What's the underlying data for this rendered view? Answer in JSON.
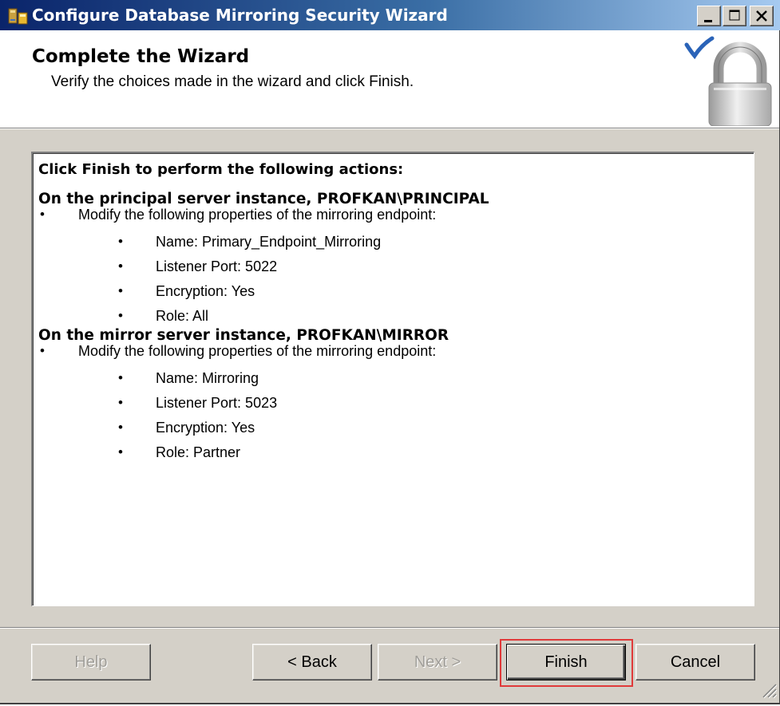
{
  "window": {
    "title": "Configure Database Mirroring Security Wizard",
    "controls": {
      "minimize": "minimize",
      "maximize": "maximize",
      "close": "close"
    }
  },
  "header": {
    "title": "Complete the Wizard",
    "subtitle": "Verify the choices made in the wizard and click Finish.",
    "graphic": "padlock-with-checkmark"
  },
  "summary": {
    "intro": "Click Finish to perform the following actions:",
    "sections": [
      {
        "title": "On the principal server instance, PROFKAN\\PRINCIPAL",
        "action": "Modify the following properties of the mirroring endpoint:",
        "properties": [
          "Name: Primary_Endpoint_Mirroring",
          "Listener Port: 5022",
          "Encryption: Yes",
          "Role: All"
        ]
      },
      {
        "title": "On the mirror server instance, PROFKAN\\MIRROR",
        "action": "Modify the following properties of the mirroring endpoint:",
        "properties": [
          "Name: Mirroring",
          "Listener Port: 5023",
          "Encryption: Yes",
          "Role: Partner"
        ]
      }
    ]
  },
  "buttons": {
    "help": "Help",
    "back": "< Back",
    "next": "Next >",
    "finish": "Finish",
    "cancel": "Cancel"
  },
  "colors": {
    "titlebar_start": "#0a246a",
    "titlebar_end": "#a6caf0",
    "dialog_face": "#d4d0c8",
    "finish_highlight": "#e03a3a"
  }
}
